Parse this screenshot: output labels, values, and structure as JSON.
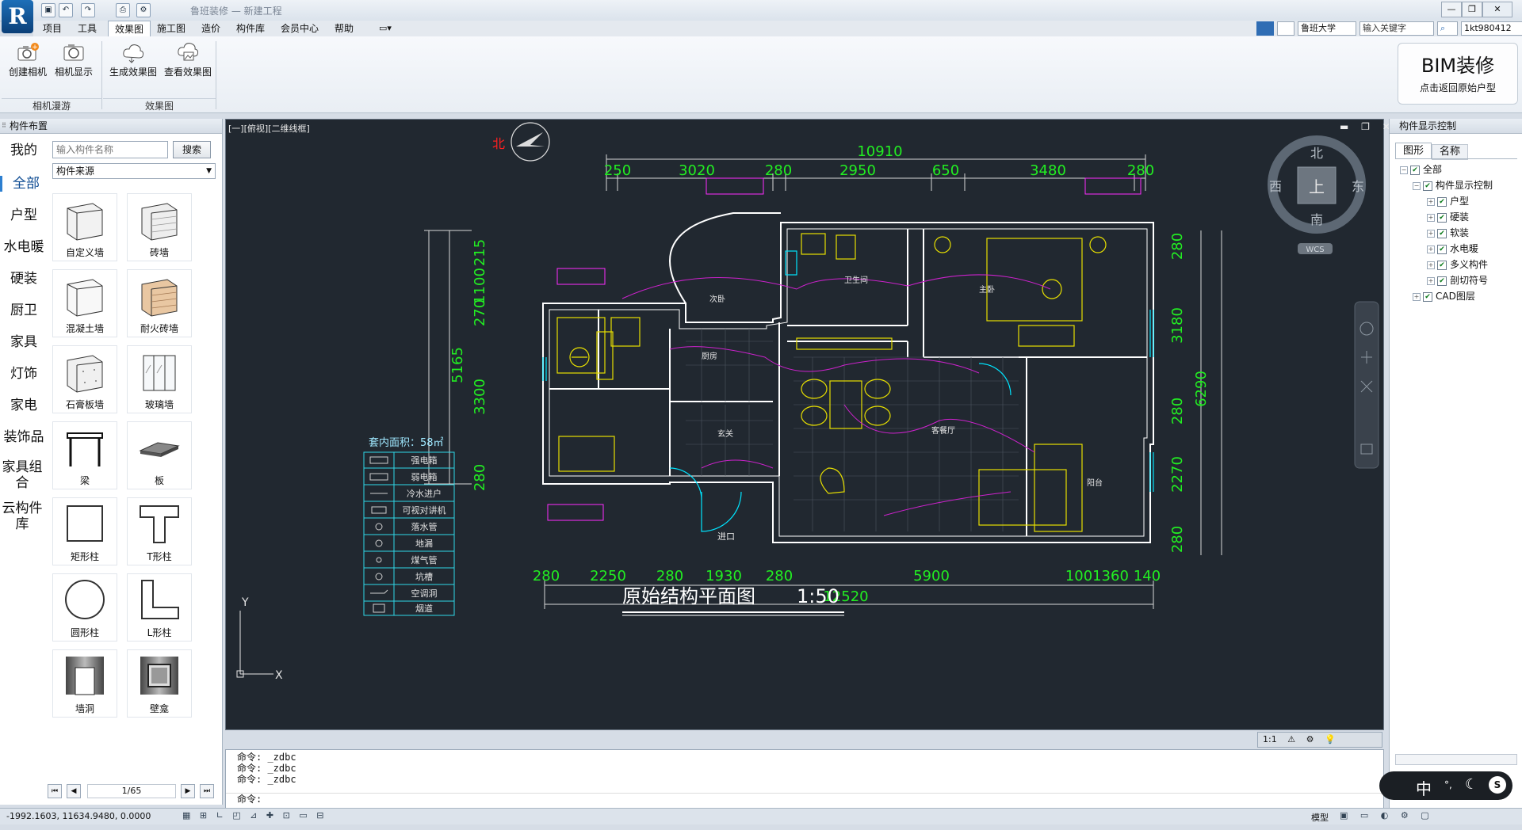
{
  "titlebar": {
    "app_title": "鲁班装修  —  新建工程",
    "window_buttons": [
      "—",
      "❐",
      "✕"
    ]
  },
  "menu": {
    "items": [
      "项目",
      "工具",
      "效果图",
      "施工图",
      "造价",
      "构件库",
      "会员中心",
      "帮助"
    ],
    "active_index": 2,
    "university": "鲁班大学",
    "keyword_placeholder": "输入关键字",
    "user": "1kt980412"
  },
  "ribbon": {
    "buttons": [
      {
        "label": "创建相机",
        "icon": "camera-plus-icon"
      },
      {
        "label": "相机显示",
        "icon": "camera-icon"
      },
      {
        "label": "生成效果图",
        "icon": "cloud-render-icon"
      },
      {
        "label": "查看效果图",
        "icon": "cloud-image-icon"
      }
    ],
    "groups": [
      "相机漫游",
      "效果图"
    ],
    "bim_title": "BIM装修",
    "bim_sub": "点击返回原始户型"
  },
  "left_panel": {
    "title": "构件布置",
    "search_placeholder": "输入构件名称",
    "search_button": "搜索",
    "source_select": "构件来源",
    "categories": [
      "我的",
      "全部",
      "户型",
      "水电暖",
      "硬装",
      "厨卫",
      "家具",
      "灯饰",
      "家电",
      "装饰品",
      "家具组合",
      "云构件库"
    ],
    "selected_category": "全部",
    "tiles": [
      "自定义墙",
      "砖墙",
      "混凝土墙",
      "耐火砖墙",
      "石膏板墙",
      "玻璃墙",
      "梁",
      "板",
      "矩形柱",
      "T形柱",
      "圆形柱",
      "L形柱",
      "墙洞",
      "壁龛"
    ],
    "pager": "1/65"
  },
  "canvas": {
    "view_label": "[一][俯视][二维线框]",
    "north_label": "北",
    "compass": {
      "n": "北",
      "s": "南",
      "e": "东",
      "w": "西",
      "center": "上",
      "wcs": "WCS"
    },
    "dims_top_total": "10910",
    "dims_top": [
      "250",
      "3020",
      "280",
      "2950",
      "650",
      "3480",
      "280"
    ],
    "dims_bottom": [
      "280",
      "2250",
      "280",
      "1930",
      "280",
      "5900",
      "100",
      "1360",
      "140"
    ],
    "dims_bottom_total": "12520",
    "dims_left": [
      "215",
      "1100",
      "270",
      "3300",
      "280"
    ],
    "dims_left_total": "5165",
    "dims_right": [
      "280",
      "3180",
      "280",
      "2270",
      "280"
    ],
    "dims_right_total": "6290",
    "area_label": "套内面积：58㎡",
    "legend": [
      "强电箱",
      "弱电箱",
      "冷水进户",
      "可视对讲机",
      "落水管",
      "地漏",
      "煤气管",
      "坑槽",
      "空调洞",
      "烟道"
    ],
    "plan_title": "原始结构平面图",
    "plan_scale": "1:50",
    "entrance_label": "进口",
    "room_labels": [
      "卫生间",
      "厨房",
      "客餐厅",
      "主卧",
      "阳台",
      "次卧",
      "玄关"
    ],
    "axis_y": "Y",
    "axis_x": "X",
    "scale_ctrl": "1:1"
  },
  "command": {
    "lines": [
      "命令: _zdbc",
      "命令: _zdbc",
      "命令: _zdbc"
    ],
    "prompt": "命令:"
  },
  "status": {
    "coords": "-1992.1603, 11634.9480, 0.0000",
    "model": "模型"
  },
  "right_panel": {
    "title": "构件显示控制",
    "tabs": [
      "图形",
      "名称"
    ],
    "tree": [
      {
        "label": "全部",
        "level": 0
      },
      {
        "label": "构件显示控制",
        "level": 1
      },
      {
        "label": "户型",
        "level": 2
      },
      {
        "label": "硬装",
        "level": 2
      },
      {
        "label": "软装",
        "level": 2
      },
      {
        "label": "水电暖",
        "level": 2
      },
      {
        "label": "多义构件",
        "level": 2
      },
      {
        "label": "剖切符号",
        "level": 2
      },
      {
        "label": "CAD图层",
        "level": 1
      }
    ]
  },
  "ime": {
    "lang": "中"
  }
}
